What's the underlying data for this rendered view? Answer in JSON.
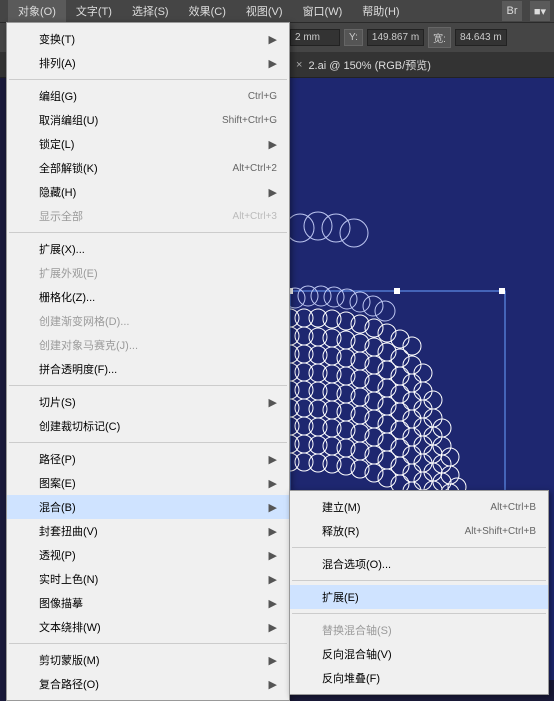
{
  "menubar": {
    "items": [
      "对象(O)",
      "文字(T)",
      "选择(S)",
      "效果(C)",
      "视图(V)",
      "窗口(W)",
      "帮助(H)"
    ],
    "activeIndex": 0
  },
  "toolbar": {
    "x_suffix": "2 mm",
    "y_label": "Y:",
    "y_value": "149.867 m",
    "w_label": "宽:",
    "w_value": "84.643 m"
  },
  "tab": {
    "close": "×",
    "title": "2.ai @ 150% (RGB/预览)"
  },
  "menu": [
    {
      "t": "item",
      "label": "变换(T)",
      "arrow": true
    },
    {
      "t": "item",
      "label": "排列(A)",
      "arrow": true
    },
    {
      "t": "sep"
    },
    {
      "t": "item",
      "label": "编组(G)",
      "shortcut": "Ctrl+G"
    },
    {
      "t": "item",
      "label": "取消编组(U)",
      "shortcut": "Shift+Ctrl+G"
    },
    {
      "t": "item",
      "label": "锁定(L)",
      "arrow": true
    },
    {
      "t": "item",
      "label": "全部解锁(K)",
      "shortcut": "Alt+Ctrl+2"
    },
    {
      "t": "item",
      "label": "隐藏(H)",
      "arrow": true
    },
    {
      "t": "item",
      "label": "显示全部",
      "shortcut": "Alt+Ctrl+3",
      "disabled": true
    },
    {
      "t": "sep"
    },
    {
      "t": "item",
      "label": "扩展(X)..."
    },
    {
      "t": "item",
      "label": "扩展外观(E)",
      "disabled": true
    },
    {
      "t": "item",
      "label": "栅格化(Z)..."
    },
    {
      "t": "item",
      "label": "创建渐变网格(D)...",
      "disabled": true
    },
    {
      "t": "item",
      "label": "创建对象马赛克(J)...",
      "disabled": true
    },
    {
      "t": "item",
      "label": "拼合透明度(F)..."
    },
    {
      "t": "sep"
    },
    {
      "t": "item",
      "label": "切片(S)",
      "arrow": true
    },
    {
      "t": "item",
      "label": "创建裁切标记(C)"
    },
    {
      "t": "sep"
    },
    {
      "t": "item",
      "label": "路径(P)",
      "arrow": true
    },
    {
      "t": "item",
      "label": "图案(E)",
      "arrow": true
    },
    {
      "t": "item",
      "label": "混合(B)",
      "arrow": true,
      "hover": true
    },
    {
      "t": "item",
      "label": "封套扭曲(V)",
      "arrow": true
    },
    {
      "t": "item",
      "label": "透视(P)",
      "arrow": true
    },
    {
      "t": "item",
      "label": "实时上色(N)",
      "arrow": true
    },
    {
      "t": "item",
      "label": "图像描摹",
      "arrow": true
    },
    {
      "t": "item",
      "label": "文本绕排(W)",
      "arrow": true
    },
    {
      "t": "sep"
    },
    {
      "t": "item",
      "label": "剪切蒙版(M)",
      "arrow": true
    },
    {
      "t": "item",
      "label": "复合路径(O)",
      "arrow": true
    }
  ],
  "submenu": [
    {
      "t": "item",
      "label": "建立(M)",
      "shortcut": "Alt+Ctrl+B"
    },
    {
      "t": "item",
      "label": "释放(R)",
      "shortcut": "Alt+Shift+Ctrl+B"
    },
    {
      "t": "sep"
    },
    {
      "t": "item",
      "label": "混合选项(O)..."
    },
    {
      "t": "sep"
    },
    {
      "t": "item",
      "label": "扩展(E)",
      "hover": true
    },
    {
      "t": "sep"
    },
    {
      "t": "item",
      "label": "替换混合轴(S)",
      "disabled": true
    },
    {
      "t": "item",
      "label": "反向混合轴(V)"
    },
    {
      "t": "item",
      "label": "反向堆叠(F)"
    }
  ]
}
